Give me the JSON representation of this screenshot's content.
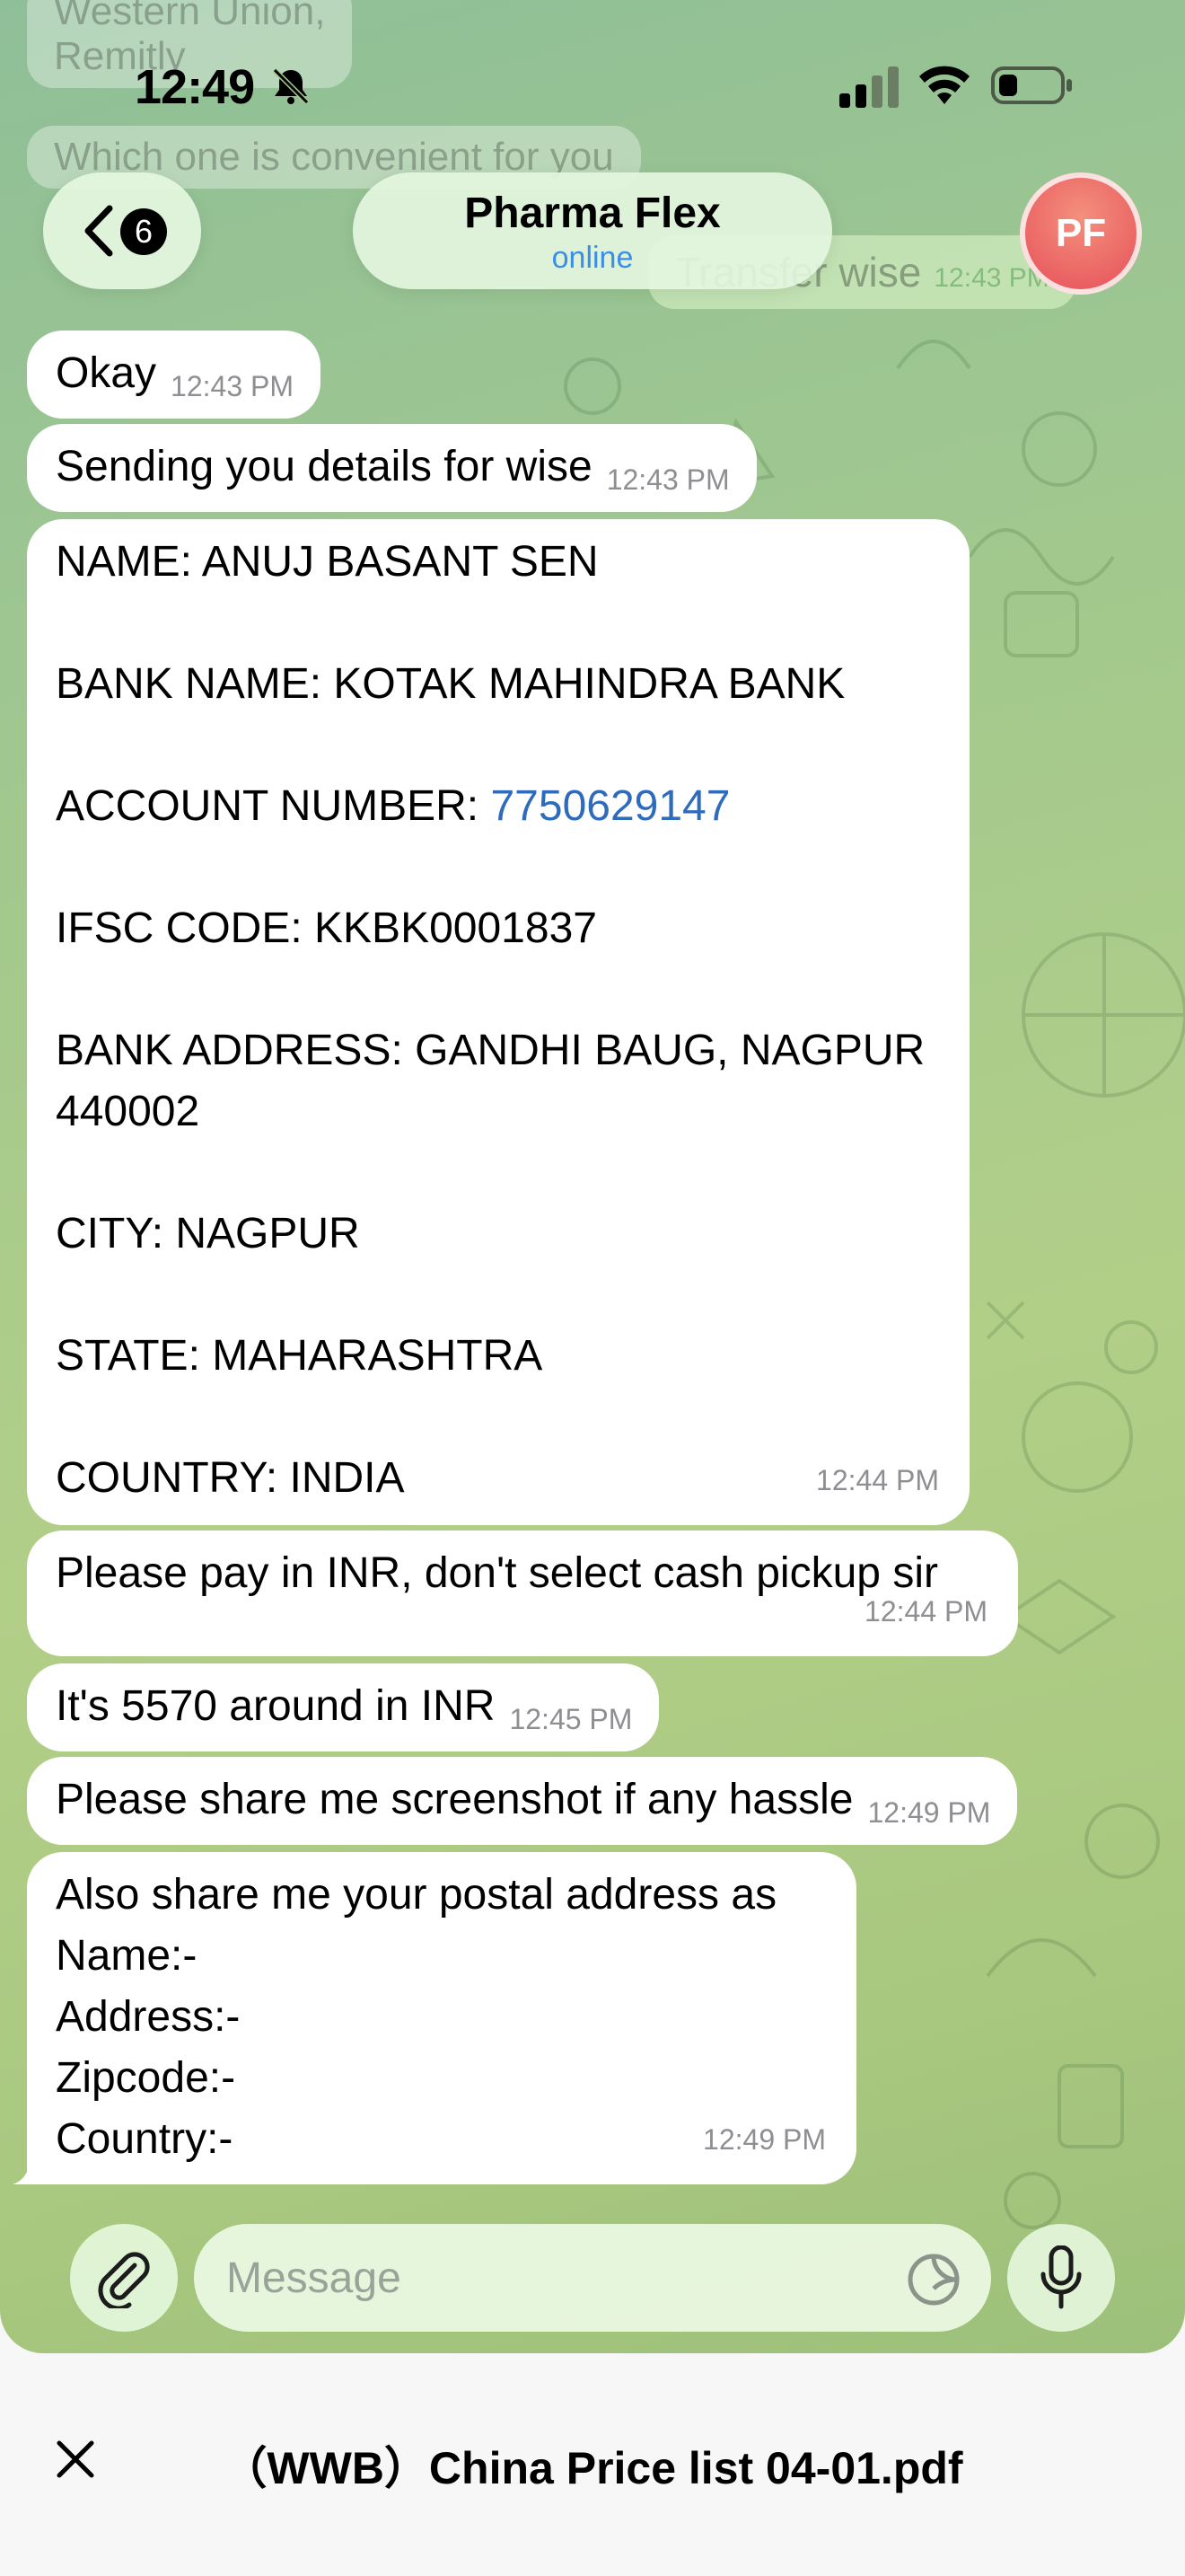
{
  "status_bar": {
    "time": "12:49"
  },
  "background_messages": {
    "incoming_1": "Western Union,",
    "incoming_2": "Remitly",
    "incoming_3": "Which one is convenient for you",
    "outgoing_text": "Transfer wise",
    "outgoing_time": "12:43 PM"
  },
  "header": {
    "back_badge": "6",
    "contact_name": "Pharma Flex",
    "contact_status": "online",
    "avatar_initials": "PF"
  },
  "messages": [
    {
      "text": "Okay",
      "time": "12:43 PM"
    },
    {
      "text": "Sending you details for wise",
      "time": "12:43 PM"
    },
    {
      "lines": {
        "name": "NAME: ANUJ BASANT SEN",
        "bank": "BANK NAME: KOTAK MAHINDRA BANK",
        "account_label": "ACCOUNT NUMBER: ",
        "account_number": "7750629147",
        "ifsc": "IFSC CODE: KKBK0001837",
        "address_1": "BANK ADDRESS: GANDHI BAUG, NAGPUR",
        "address_2": "440002",
        "city": "CITY: NAGPUR",
        "state": "STATE: MAHARASHTRA",
        "country": "COUNTRY: INDIA"
      },
      "time": "12:44 PM"
    },
    {
      "text": "Please pay in INR, don't select cash pickup sir",
      "time": "12:44 PM"
    },
    {
      "text": "It's 5570 around in INR",
      "time": "12:45 PM"
    },
    {
      "text": "Please share me screenshot if any hassle",
      "time": "12:49 PM"
    },
    {
      "lines": {
        "l1": "Also share me your postal address as",
        "l2": "Name:-",
        "l3": "Address:-",
        "l4": "Zipcode:-",
        "l5": "Country:-"
      },
      "time": "12:49 PM"
    }
  ],
  "input": {
    "placeholder": "Message"
  },
  "document_bar": {
    "title": "（WWB）China Price list 04-01.pdf"
  },
  "colors": {
    "link": "#2f6bbb",
    "online": "#3a8ee6",
    "avatar": "#e6505a",
    "chat_background": "#a4c98d"
  },
  "icons": [
    "bell-slash-icon",
    "signal-icon",
    "wifi-icon",
    "battery-icon",
    "back-chevron-icon",
    "attach-icon",
    "sticker-icon",
    "microphone-icon",
    "close-icon"
  ]
}
